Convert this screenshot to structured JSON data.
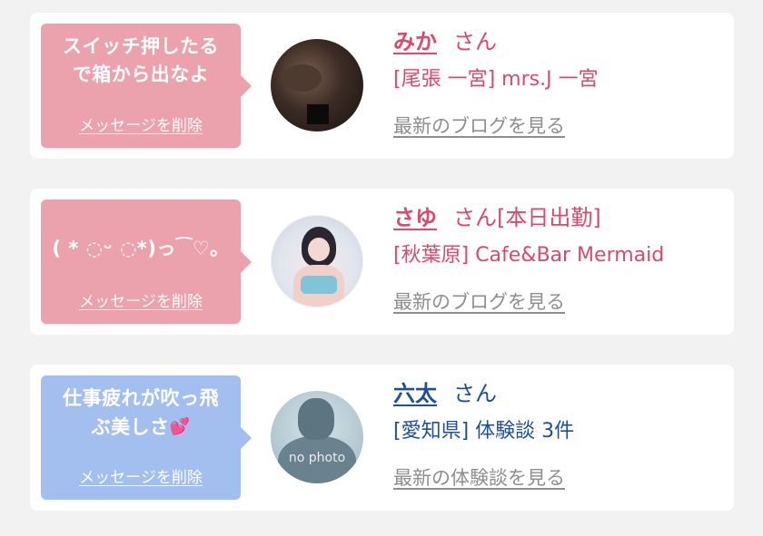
{
  "cards": [
    {
      "message": "スイッチ押したる\nで箱から出なよ",
      "delete_label": "メッセージを削除",
      "name": "みか",
      "suffix": "さん",
      "shop": "[尾張 一宮] mrs.J 一宮",
      "link": "最新のブログを見る",
      "theme_color": "#eca2ad",
      "text_color": "#d94a6d"
    },
    {
      "message": "( * ◌ᵕ ◌*)っ⁀♡。",
      "delete_label": "メッセージを削除",
      "name": "さゆ",
      "suffix": "さん[本日出勤]",
      "shop": "[秋葉原] Cafe&Bar Mermaid",
      "link": "最新のブログを見る",
      "theme_color": "#eca2ad",
      "text_color": "#d94a6d"
    },
    {
      "message": "仕事疲れが吹っ飛\nぶ美しさ",
      "message_emoji": "heart-icon",
      "delete_label": "メッセージを削除",
      "name": "六太",
      "suffix": "さん",
      "shop": "[愛知県] 体験談 3件",
      "link": "最新の体験談を見る",
      "avatar_text": "no photo",
      "theme_color": "#a2bff0",
      "text_color": "#1f4f96"
    }
  ]
}
